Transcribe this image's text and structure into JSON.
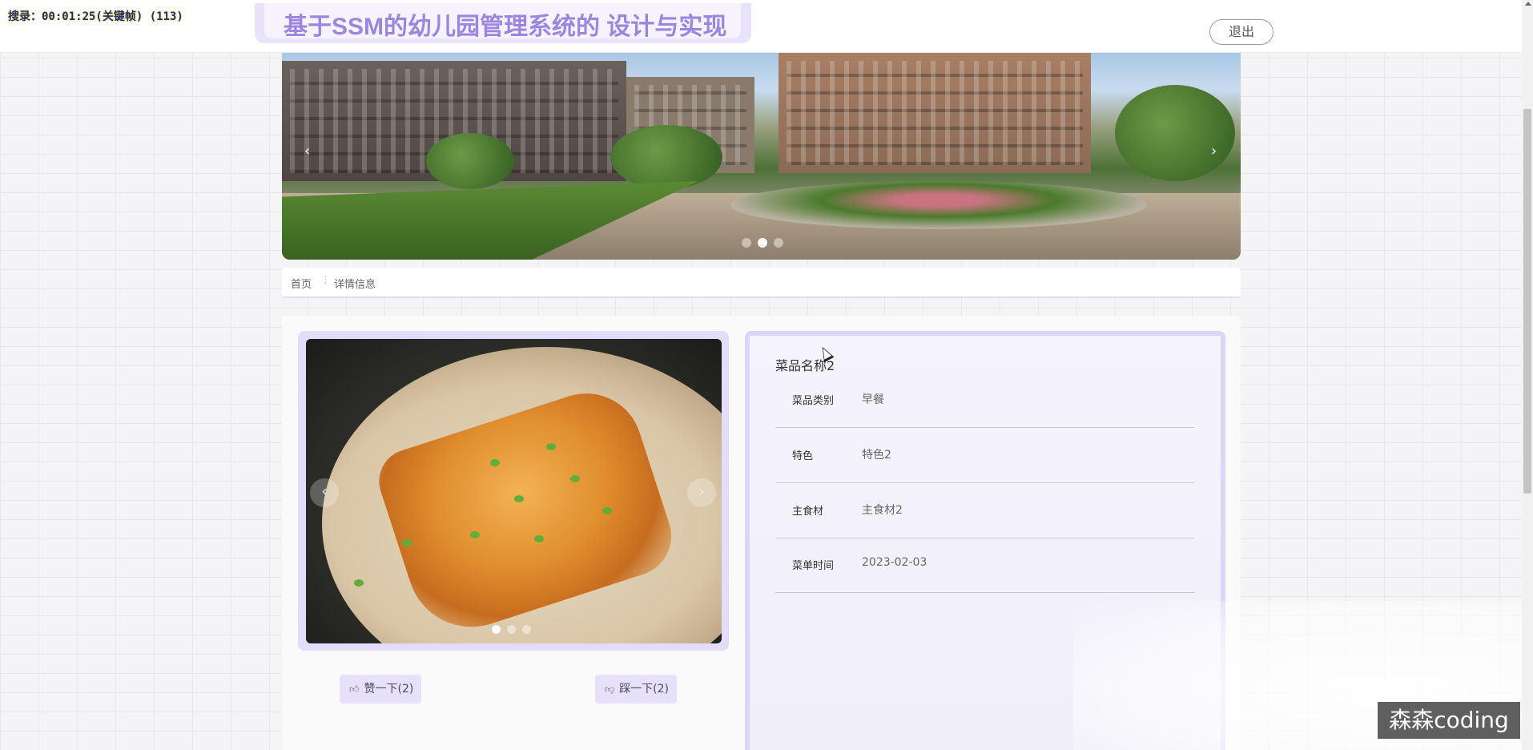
{
  "recorder": {
    "text": "搜录：00:01:25(关键帧) (113)"
  },
  "header": {
    "site_title": "基于SSM的幼儿园管理系统的 设计与实现",
    "logout_label": "退出"
  },
  "banner": {
    "prev_glyph": "‹",
    "next_glyph": "›",
    "slide_count": 3,
    "active_slide": 2
  },
  "breadcrumb": {
    "home": "首页",
    "separator": "⋮",
    "current": "详情信息"
  },
  "gallery": {
    "prev_glyph": "‹",
    "next_glyph": "›",
    "slide_count": 3,
    "active_slide": 1
  },
  "actions": {
    "like_icon": "thumbs-up-icon",
    "like_label": "赞一下(2)",
    "dislike_icon": "thumbs-down-icon",
    "dislike_label": "踩一下(2)"
  },
  "detail": {
    "name": "菜品名称2",
    "fields": [
      {
        "label": "菜品类别",
        "value": "早餐"
      },
      {
        "label": "特色",
        "value": "特色2"
      },
      {
        "label": "主食材",
        "value": "主食材2"
      },
      {
        "label": "菜单时间",
        "value": "2023-02-03"
      }
    ]
  },
  "watermark": "森森coding",
  "colors": {
    "accent": "#9a86e0",
    "accent_light": "#e6e0fa",
    "panel_border": "#dcd5f7"
  }
}
